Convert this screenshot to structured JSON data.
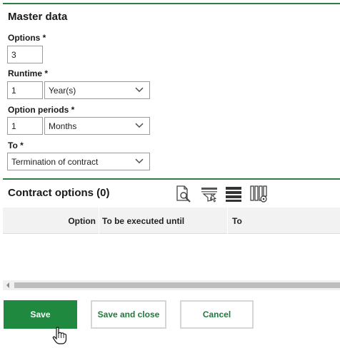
{
  "master": {
    "title": "Master data",
    "options_label": "Options *",
    "options_value": "3",
    "runtime_label": "Runtime *",
    "runtime_value": "1",
    "runtime_unit": "Year(s)",
    "option_periods_label": "Option periods *",
    "option_periods_value": "1",
    "option_periods_unit": "Months",
    "to_label": "To *",
    "to_value": "Termination of contract"
  },
  "contract_options": {
    "title": "Contract options (0)",
    "columns": [
      "Option",
      "To be executed until",
      "To"
    ]
  },
  "buttons": {
    "save": "Save",
    "save_and_close": "Save and close",
    "cancel": "Cancel"
  },
  "colors": {
    "accent": "#1f8a3f",
    "divider": "#2e7d43"
  },
  "icons": [
    "document-search-icon",
    "filter-select-icon",
    "rows-icon",
    "column-settings-icon",
    "chevron-down-icon",
    "hand-cursor-icon"
  ]
}
